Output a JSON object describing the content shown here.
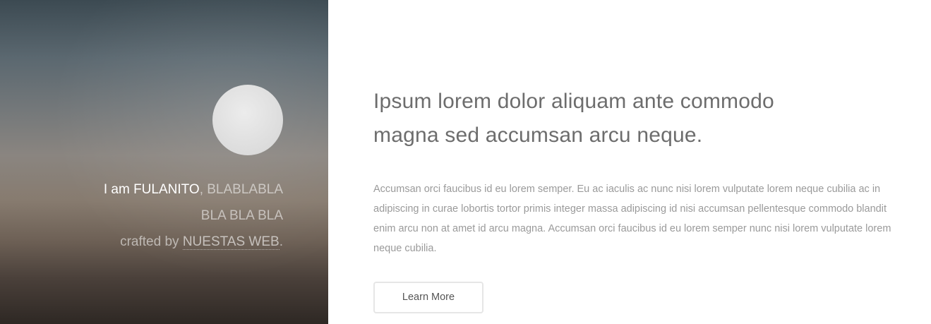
{
  "sidebar": {
    "intro_line1_prefix": "I am ",
    "intro_name": "FULANITO",
    "intro_sep": ", ",
    "intro_line1_suffix": "BLABLABLA",
    "intro_line2": "BLA BLA BLA",
    "intro_line3_prefix": "crafted by ",
    "intro_link": "NUESTAS WEB",
    "intro_line3_suffix": "."
  },
  "main": {
    "heading_line1": "Ipsum lorem dolor aliquam ante commodo",
    "heading_line2": "magna sed accumsan arcu neque.",
    "paragraph": "Accumsan orci faucibus id eu lorem semper. Eu ac iaculis ac nunc nisi lorem vulputate lorem neque cubilia ac in adipiscing in curae lobortis tortor primis integer massa adipiscing id nisi accumsan pellentesque commodo blandit enim arcu non at amet id arcu magna. Accumsan orci faucibus id eu lorem semper nunc nisi lorem vulputate lorem neque cubilia.",
    "button_label": "Learn More"
  },
  "colors": {
    "heading": "#6d6d6d",
    "paragraph": "#9a9a9a",
    "button_border": "#e6e6e6"
  }
}
